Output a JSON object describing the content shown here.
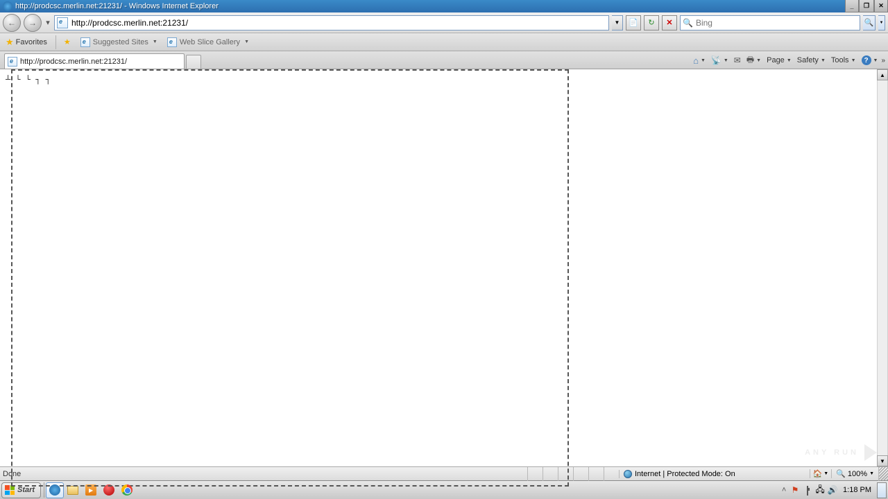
{
  "titlebar": {
    "title": "http://prodcsc.merlin.net:21231/ - Windows Internet Explorer"
  },
  "nav": {
    "url": "http://prodcsc.merlin.net:21231/",
    "search_placeholder": "Bing"
  },
  "favbar": {
    "favorites": "Favorites",
    "suggested": "Suggested Sites",
    "webslice": "Web Slice Gallery"
  },
  "tab": {
    "title": "http://prodcsc.merlin.net:21231/"
  },
  "cmdbar": {
    "page": "Page",
    "safety": "Safety",
    "tools": "Tools"
  },
  "page": {
    "body": "┴ └ └ ┐ ┐"
  },
  "statusbar": {
    "left": "Done",
    "mode": "Internet | Protected Mode: On",
    "zoom": "100%"
  },
  "taskbar": {
    "start": "Start",
    "clock": "1:18 PM"
  },
  "watermark": {
    "text": "ANY   RUN"
  }
}
